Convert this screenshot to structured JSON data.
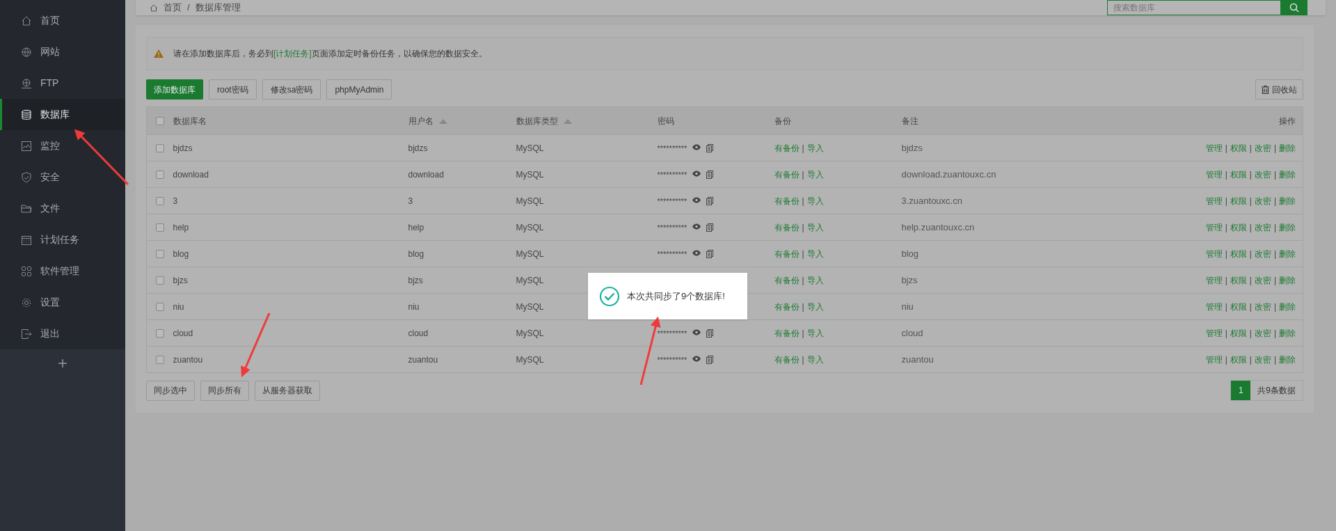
{
  "sidebar": {
    "items": [
      {
        "label": "首页",
        "selected": false
      },
      {
        "label": "网站",
        "selected": false
      },
      {
        "label": "FTP",
        "selected": false
      },
      {
        "label": "数据库",
        "selected": true
      },
      {
        "label": "监控",
        "selected": false
      },
      {
        "label": "安全",
        "selected": false
      },
      {
        "label": "文件",
        "selected": false
      },
      {
        "label": "计划任务",
        "selected": false
      },
      {
        "label": "软件管理",
        "selected": false
      },
      {
        "label": "设置",
        "selected": false
      },
      {
        "label": "退出",
        "selected": false
      }
    ],
    "add": "+"
  },
  "breadcrumb": [
    "首页",
    "数据库管理"
  ],
  "breadcrumb_separator": "/",
  "search": {
    "placeholder": "搜索数据库"
  },
  "alert": {
    "before": "请在添加数据库后，务必到",
    "link": "[计划任务]",
    "after": "页面添加定时备份任务，以确保您的数据安全。"
  },
  "toolbar": [
    {
      "label": "添加数据库",
      "kind": "primary"
    },
    {
      "label": "root密码",
      "kind": "default"
    },
    {
      "label": "修改sa密码",
      "kind": "default"
    },
    {
      "label": "phpMyAdmin",
      "kind": "default"
    }
  ],
  "recycle": "回收站",
  "table": {
    "all_checked": false,
    "columns": [
      {
        "label": "数据库名",
        "sortable": false
      },
      {
        "label": "用户名",
        "sortable": true
      },
      {
        "label": "数据库类型",
        "sortable": true
      },
      {
        "label": "密码",
        "sortable": false
      },
      {
        "label": "备份",
        "sortable": false
      },
      {
        "label": "备注",
        "sortable": false
      },
      {
        "label": "操作",
        "sortable": false
      }
    ],
    "rows": [
      {
        "checked": false,
        "name": "bjdzs",
        "user": "bjdzs",
        "type": "MySQL",
        "password": "**********",
        "backup": [
          "有备份",
          "|",
          "导入"
        ],
        "note": "bjdzs",
        "actions": [
          "管理",
          "|",
          "权限",
          "|",
          "改密",
          "|",
          "删除"
        ]
      },
      {
        "checked": false,
        "name": "download",
        "user": "download",
        "type": "MySQL",
        "password": "**********",
        "backup": [
          "有备份",
          "|",
          "导入"
        ],
        "note": "download.zuantouxc.cn",
        "actions": [
          "管理",
          "|",
          "权限",
          "|",
          "改密",
          "|",
          "删除"
        ]
      },
      {
        "checked": false,
        "name": "3",
        "user": "3",
        "type": "MySQL",
        "password": "**********",
        "backup": [
          "有备份",
          "|",
          "导入"
        ],
        "note": "3.zuantouxc.cn",
        "actions": [
          "管理",
          "|",
          "权限",
          "|",
          "改密",
          "|",
          "删除"
        ]
      },
      {
        "checked": false,
        "name": "help",
        "user": "help",
        "type": "MySQL",
        "password": "**********",
        "backup": [
          "有备份",
          "|",
          "导入"
        ],
        "note": "help.zuantouxc.cn",
        "actions": [
          "管理",
          "|",
          "权限",
          "|",
          "改密",
          "|",
          "删除"
        ]
      },
      {
        "checked": false,
        "name": "blog",
        "user": "blog",
        "type": "MySQL",
        "password": "**********",
        "backup": [
          "有备份",
          "|",
          "导入"
        ],
        "note": "blog",
        "actions": [
          "管理",
          "|",
          "权限",
          "|",
          "改密",
          "|",
          "删除"
        ]
      },
      {
        "checked": false,
        "name": "bjzs",
        "user": "bjzs",
        "type": "MySQL",
        "backup": [
          "有备份",
          "|",
          "导入"
        ],
        "note": "bjzs",
        "actions": [
          "管理",
          "|",
          "权限",
          "|",
          "改密",
          "|",
          "删除"
        ]
      },
      {
        "checked": false,
        "name": "niu",
        "user": "niu",
        "type": "MySQL",
        "backup": [
          "有备份",
          "|",
          "导入"
        ],
        "note": "niu",
        "actions": [
          "管理",
          "|",
          "权限",
          "|",
          "改密",
          "|",
          "删除"
        ]
      },
      {
        "checked": false,
        "name": "cloud",
        "user": "cloud",
        "type": "MySQL",
        "password": "**********",
        "backup": [
          "有备份",
          "|",
          "导入"
        ],
        "note": "cloud",
        "actions": [
          "管理",
          "|",
          "权限",
          "|",
          "改密",
          "|",
          "删除"
        ]
      },
      {
        "checked": false,
        "name": "zuantou",
        "user": "zuantou",
        "type": "MySQL",
        "password": "**********",
        "backup": [
          "有备份",
          "|",
          "导入"
        ],
        "note": "zuantou",
        "actions": [
          "管理",
          "|",
          "权限",
          "|",
          "改密",
          "|",
          "删除"
        ]
      }
    ]
  },
  "bottom_buttons": [
    "同步选中",
    "同步所有",
    "从服务器获取"
  ],
  "pagination": {
    "pages": [
      {
        "label": "1",
        "selected": true
      }
    ],
    "total": "共9条数据"
  },
  "toast": "本次共同步了9个数据库!"
}
